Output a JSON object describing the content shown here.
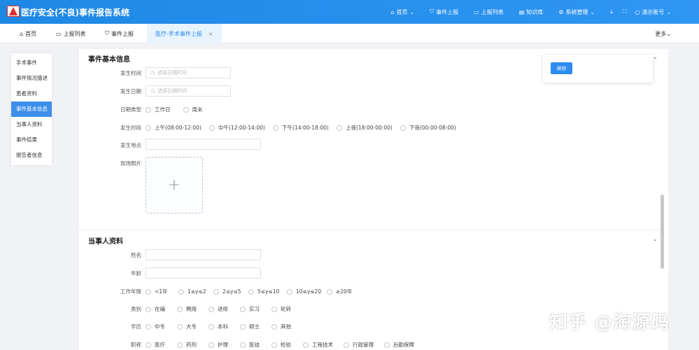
{
  "header": {
    "title": "医疗安全(不良)事件报告系统",
    "nav": [
      {
        "label": "首页",
        "icon": "home-icon",
        "glyph": "⌂",
        "dropdown": true
      },
      {
        "label": "事件上报",
        "icon": "shield-icon",
        "glyph": "⛉",
        "dropdown": false
      },
      {
        "label": "上报列表",
        "icon": "monitor-icon",
        "glyph": "▭",
        "dropdown": false
      },
      {
        "label": "知识库",
        "icon": "book-icon",
        "glyph": "▤",
        "dropdown": false
      },
      {
        "label": "系统管理",
        "icon": "gear-icon",
        "glyph": "⚙",
        "dropdown": true
      }
    ],
    "user": "演示账号"
  },
  "tabs": [
    {
      "label": "首页",
      "glyph": "⌂"
    },
    {
      "label": "上报列表",
      "glyph": "▭"
    },
    {
      "label": "事件上报",
      "glyph": "⛉"
    },
    {
      "label": "医疗-手术事件上报",
      "close": "×"
    }
  ],
  "more_label": "更多",
  "sidebar": [
    {
      "label": "手术事件",
      "active": false
    },
    {
      "label": "事件情况描述",
      "active": false
    },
    {
      "label": "患者资料",
      "active": false
    },
    {
      "label": "事件基本信息",
      "active": true
    },
    {
      "label": "当事人资料",
      "active": false
    },
    {
      "label": "事件结果",
      "active": false
    },
    {
      "label": "报告者信息",
      "active": false
    }
  ],
  "basic_info": {
    "title": "事件基本信息",
    "time_label": "发生时间",
    "time_placeholder": "选择日期时间",
    "date_label": "发生日期",
    "date_placeholder": "选择日期时间",
    "date_type_label": "日期类型",
    "date_type_options": [
      "工作日",
      "周末"
    ],
    "period_label": "发生时段",
    "period_options": [
      "上午(08:00-12:00)",
      "中午(12:00-14:00)",
      "下午(14:00-18:00)",
      "上夜(18:00-00:00)",
      "下夜(00:00-08:00)"
    ],
    "location_label": "发生地点",
    "photo_label": "现场照片",
    "upload_plus": "+"
  },
  "party_info": {
    "title": "当事人资料",
    "name_label": "姓名",
    "age_label": "年龄",
    "years_label": "工作年限",
    "years_options": [
      "<1年",
      "1≤y≤2",
      "2≤y≤5",
      "5≤y≤10",
      "10≤y≤20",
      "≥20年"
    ],
    "category_label": "类别",
    "category_options": [
      "在编",
      "聘用",
      "进修",
      "实习",
      "轮转"
    ],
    "edu_label": "学历",
    "edu_options": [
      "中专",
      "大专",
      "本科",
      "硕士",
      "其他"
    ],
    "title_label": "职称",
    "title_options": [
      "医疗",
      "药剂",
      "护理",
      "医技",
      "检验",
      "工程技术",
      "行政管理",
      "后勤保障"
    ]
  },
  "save_label": "保存",
  "watermark": "知乎 @淘源码"
}
